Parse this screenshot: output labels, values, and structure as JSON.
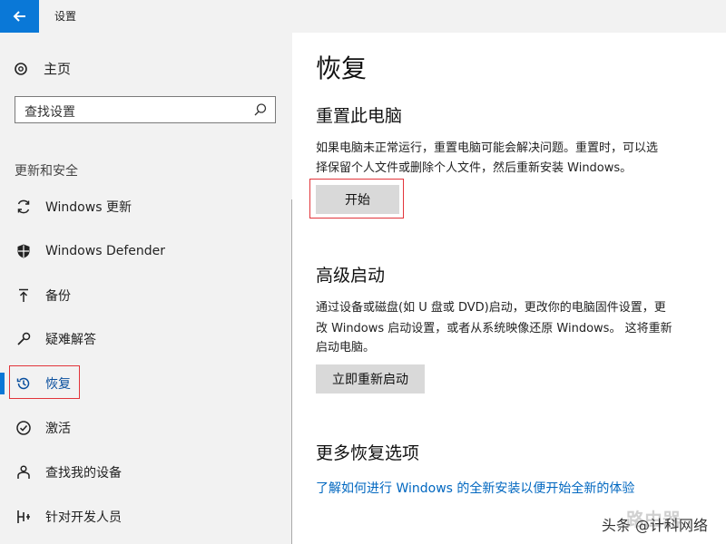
{
  "window": {
    "title": "设置"
  },
  "sidebar": {
    "home_label": "主页",
    "search_placeholder": "查找设置",
    "section_title": "更新和安全",
    "items": [
      {
        "label": "Windows 更新",
        "icon": "sync-icon"
      },
      {
        "label": "Windows Defender",
        "icon": "shield-icon"
      },
      {
        "label": "备份",
        "icon": "backup-icon"
      },
      {
        "label": "疑难解答",
        "icon": "wrench-icon"
      },
      {
        "label": "恢复",
        "icon": "recovery-icon",
        "active": true
      },
      {
        "label": "激活",
        "icon": "check-circle-icon"
      },
      {
        "label": "查找我的设备",
        "icon": "person-locate-icon"
      },
      {
        "label": "针对开发人员",
        "icon": "developer-icon"
      }
    ]
  },
  "main": {
    "title": "恢复",
    "reset": {
      "heading": "重置此电脑",
      "description_line1": "如果电脑未正常运行，重置电脑可能会解决问题。重置时，可以选",
      "description_line2": "择保留个人文件或删除个人文件，然后重新安装 Windows。",
      "button": "开始"
    },
    "advanced": {
      "heading": "高级启动",
      "description_line1": "通过设备或磁盘(如 U 盘或 DVD)启动，更改你的电脑固件设置，更",
      "description_line2": "改 Windows 启动设置，或者从系统映像还原 Windows。 这将重新",
      "description_line3": "启动电脑。",
      "button": "立即重新启动"
    },
    "more": {
      "heading": "更多恢复选项",
      "link": "了解如何进行 Windows 的全新安装以便开始全新的体验"
    }
  },
  "watermark": {
    "text": "头条 @计科网络",
    "logo_text": "路由器"
  },
  "colors": {
    "accent": "#0a78d7",
    "highlight": "#e2343a",
    "link": "#0067c0"
  }
}
